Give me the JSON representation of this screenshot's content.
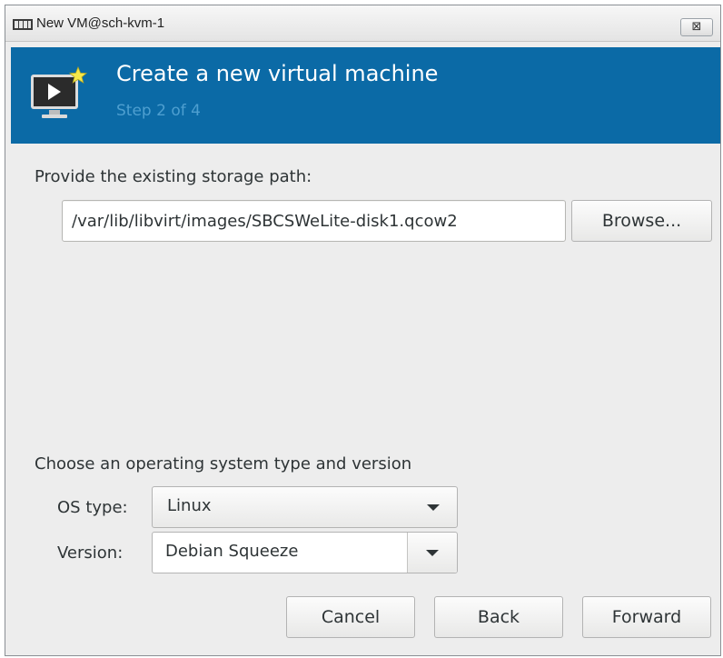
{
  "window": {
    "title": "New VM@sch-kvm-1",
    "close_glyph": "⊠"
  },
  "header": {
    "title": "Create a new virtual machine",
    "step": "Step 2 of 4",
    "icon": "monitor-play-icon",
    "background_color": "#0b6aa6"
  },
  "storage": {
    "label": "Provide the existing storage path:",
    "path_value": "/var/lib/libvirt/images/SBCSWeLite-disk1.qcow2",
    "browse_label": "Browse..."
  },
  "os": {
    "section_label": "Choose an operating system type and version",
    "type_label": "OS type:",
    "type_value": "Linux",
    "version_label": "Version:",
    "version_value": "Debian Squeeze"
  },
  "buttons": {
    "cancel": "Cancel",
    "back": "Back",
    "forward": "Forward"
  }
}
